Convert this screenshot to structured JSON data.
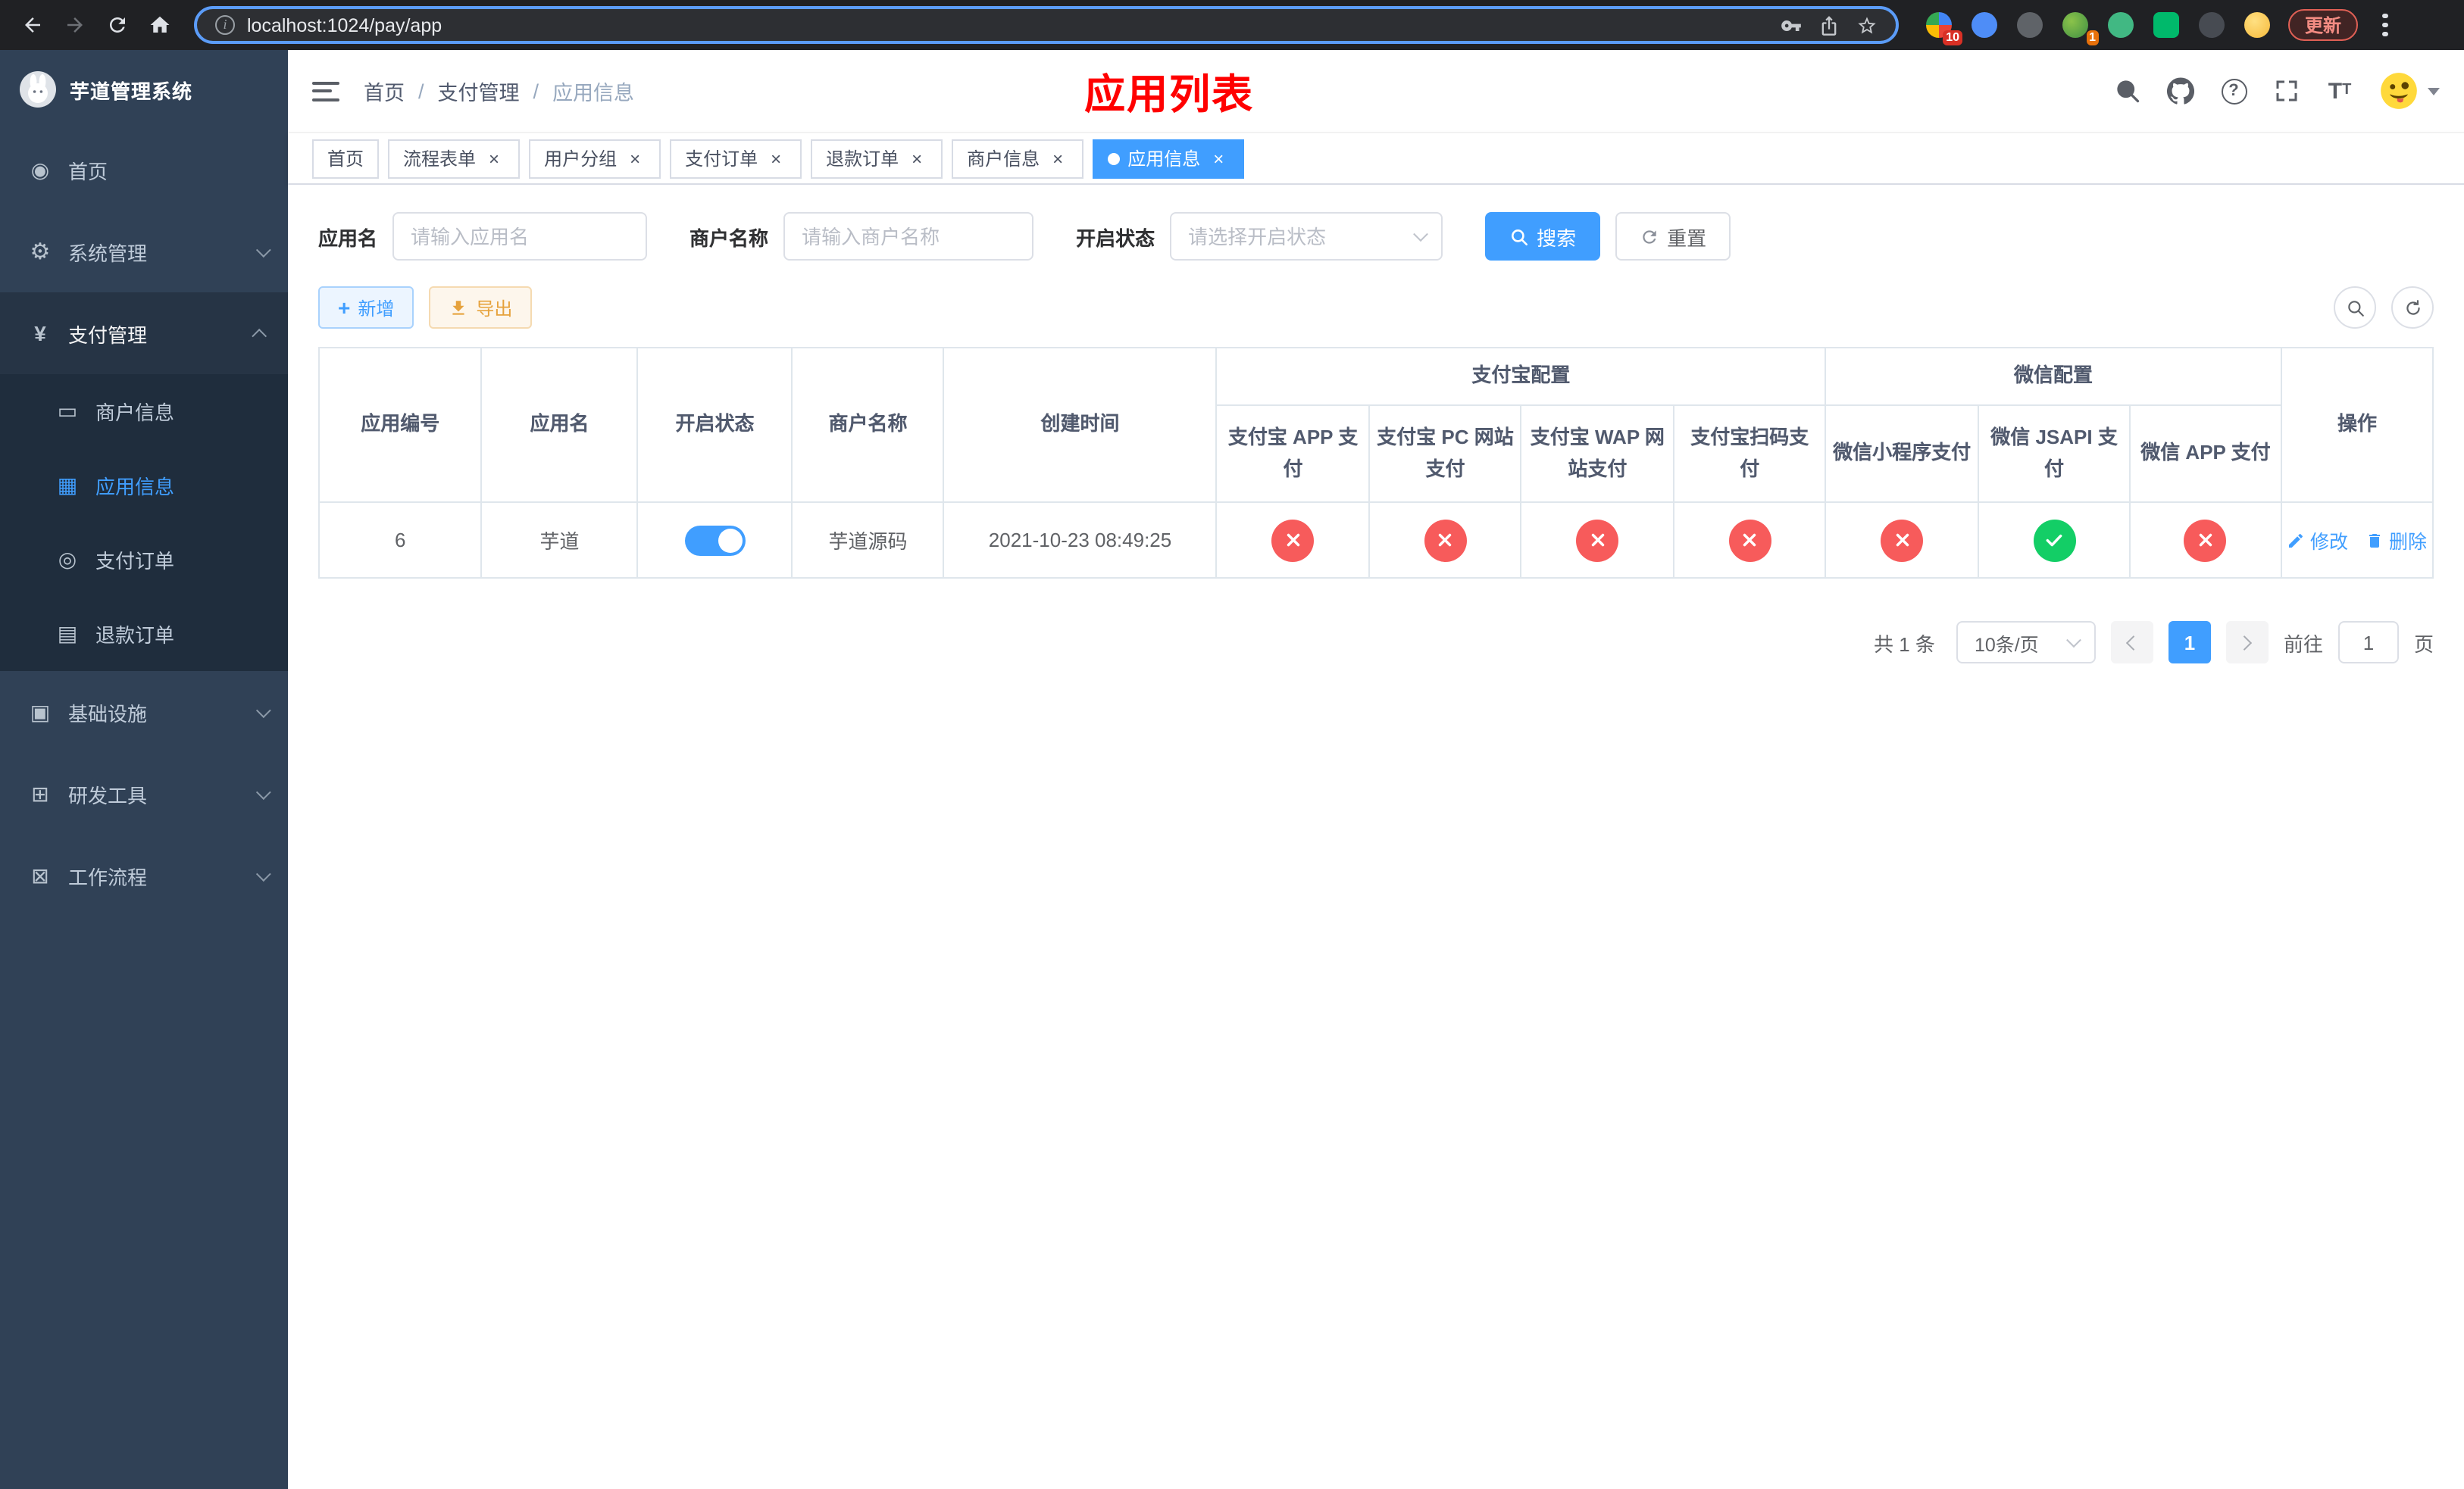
{
  "browser": {
    "url": "localhost:1024/pay/app",
    "update_label": "更新",
    "extension_badge_10": "10",
    "extension_badge_1": "1"
  },
  "sidebar": {
    "logo_title": "芋道管理系统",
    "items": [
      {
        "label": "首页",
        "icon": "dashboard-icon"
      },
      {
        "label": "系统管理",
        "icon": "gear-icon"
      },
      {
        "label": "支付管理",
        "icon": "yen-icon"
      },
      {
        "label": "商户信息",
        "icon": "credit-card-icon"
      },
      {
        "label": "应用信息",
        "icon": "grid-icon"
      },
      {
        "label": "支付订单",
        "icon": "order-icon"
      },
      {
        "label": "退款订单",
        "icon": "document-icon"
      },
      {
        "label": "基础设施",
        "icon": "infrastructure-icon"
      },
      {
        "label": "研发工具",
        "icon": "tools-icon"
      },
      {
        "label": "工作流程",
        "icon": "workflow-icon"
      }
    ]
  },
  "header": {
    "breadcrumb": {
      "level1": "首页",
      "level2": "支付管理",
      "level3": "应用信息"
    },
    "page_title": "应用列表"
  },
  "tabs": [
    {
      "label": "首页"
    },
    {
      "label": "流程表单"
    },
    {
      "label": "用户分组"
    },
    {
      "label": "支付订单"
    },
    {
      "label": "退款订单"
    },
    {
      "label": "商户信息"
    },
    {
      "label": "应用信息"
    }
  ],
  "filters": {
    "app_name_label": "应用名",
    "app_name_placeholder": "请输入应用名",
    "merchant_label": "商户名称",
    "merchant_placeholder": "请输入商户名称",
    "status_label": "开启状态",
    "status_placeholder": "请选择开启状态",
    "search_label": "搜索",
    "reset_label": "重置"
  },
  "toolbar": {
    "add_label": "新增",
    "export_label": "导出"
  },
  "table": {
    "col_app_id": "应用编号",
    "col_app_name": "应用名",
    "col_status": "开启状态",
    "col_merchant": "商户名称",
    "col_created": "创建时间",
    "group_alipay": "支付宝配置",
    "group_wechat": "微信配置",
    "col_alipay_app": "支付宝 APP 支付",
    "col_alipay_pc": "支付宝 PC 网站支付",
    "col_alipay_wap": "支付宝 WAP 网站支付",
    "col_alipay_qr": "支付宝扫码支付",
    "col_wechat_mini": "微信小程序支付",
    "col_wechat_jsapi": "微信 JSAPI 支付",
    "col_wechat_app": "微信 APP 支付",
    "col_actions": "操作",
    "rows": [
      {
        "app_id": "6",
        "app_name": "芋道",
        "status_on": true,
        "merchant": "芋道源码",
        "created": "2021-10-23 08:49:25",
        "channels": {
          "alipay_app": false,
          "alipay_pc": false,
          "alipay_wap": false,
          "alipay_qr": false,
          "wechat_mini": false,
          "wechat_jsapi": true,
          "wechat_app": false
        },
        "edit_label": "修改",
        "delete_label": "删除"
      }
    ]
  },
  "pagination": {
    "total": "共 1 条",
    "page_size": "10条/页",
    "page": "1",
    "goto_prefix": "前往",
    "goto_value": "1",
    "goto_suffix": "页"
  },
  "colors": {
    "primary": "#409eff",
    "success": "#13ce66",
    "danger": "#f75b5b",
    "warning": "#e6a23c",
    "page_title_red": "#ff0000",
    "sidebar_bg": "#304156",
    "submenu_bg": "#1f2d3d"
  }
}
